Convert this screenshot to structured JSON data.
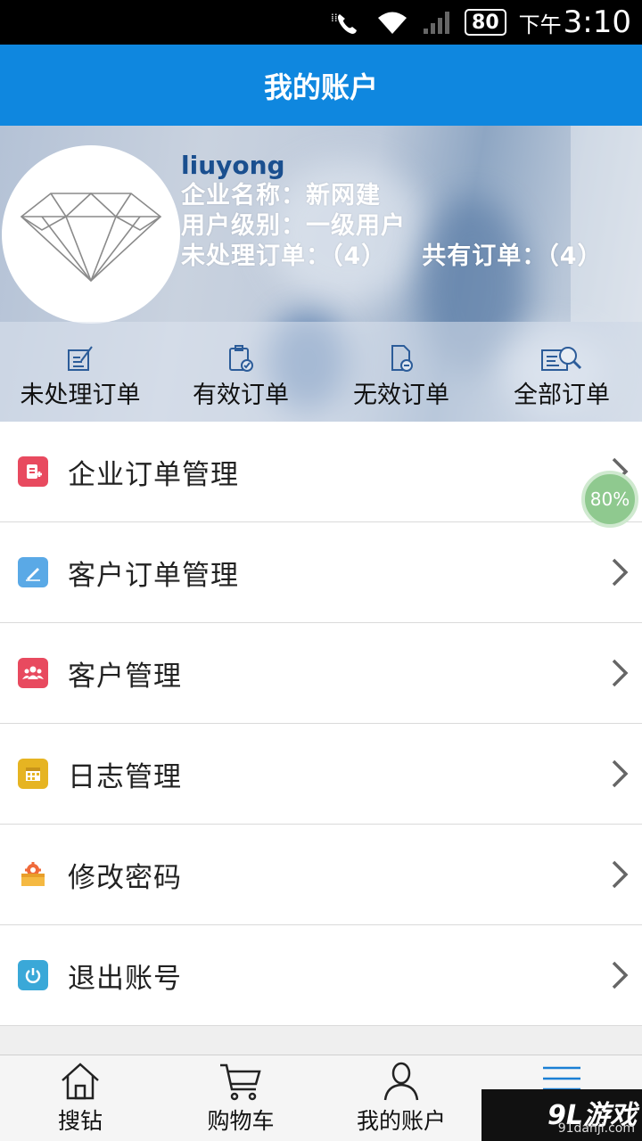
{
  "status_bar": {
    "battery": "80",
    "ampm": "下午",
    "time": "3:10"
  },
  "header": {
    "title": "我的账户"
  },
  "profile": {
    "username": "liuyong",
    "company": "企业名称：新网建",
    "level": "用户级别：一级用户",
    "pending_orders": "未处理订单：（4）",
    "total_orders": "共有订单：（4）"
  },
  "quick_actions": [
    {
      "label": "未处理订单",
      "icon": "pencil-document-icon"
    },
    {
      "label": "有效订单",
      "icon": "clipboard-check-icon"
    },
    {
      "label": "无效订单",
      "icon": "document-invalid-icon"
    },
    {
      "label": "全部订单",
      "icon": "search-list-icon"
    }
  ],
  "menu": [
    {
      "label": "企业订单管理",
      "icon": "enterprise-order-icon",
      "color": "#e84a5f"
    },
    {
      "label": "客户订单管理",
      "icon": "edit-icon",
      "color": "#5aa9e6"
    },
    {
      "label": "客户管理",
      "icon": "group-icon",
      "color": "#e84a5f"
    },
    {
      "label": "日志管理",
      "icon": "calendar-icon",
      "color": "#e6b422"
    },
    {
      "label": "修改密码",
      "icon": "gear-box-icon",
      "color": "#f0a030"
    },
    {
      "label": "退出账号",
      "icon": "power-icon",
      "color": "#3aa8d8"
    }
  ],
  "floating_badge": "80%",
  "tabs": [
    {
      "label": "搜钻",
      "icon": "home-icon"
    },
    {
      "label": "购物车",
      "icon": "cart-icon"
    },
    {
      "label": "我的账户",
      "icon": "user-icon"
    },
    {
      "label": "",
      "icon": "menu-icon"
    }
  ],
  "watermark": {
    "brand": "9L游戏",
    "site": "91danji.com"
  },
  "colors": {
    "primary": "#0f87df"
  }
}
